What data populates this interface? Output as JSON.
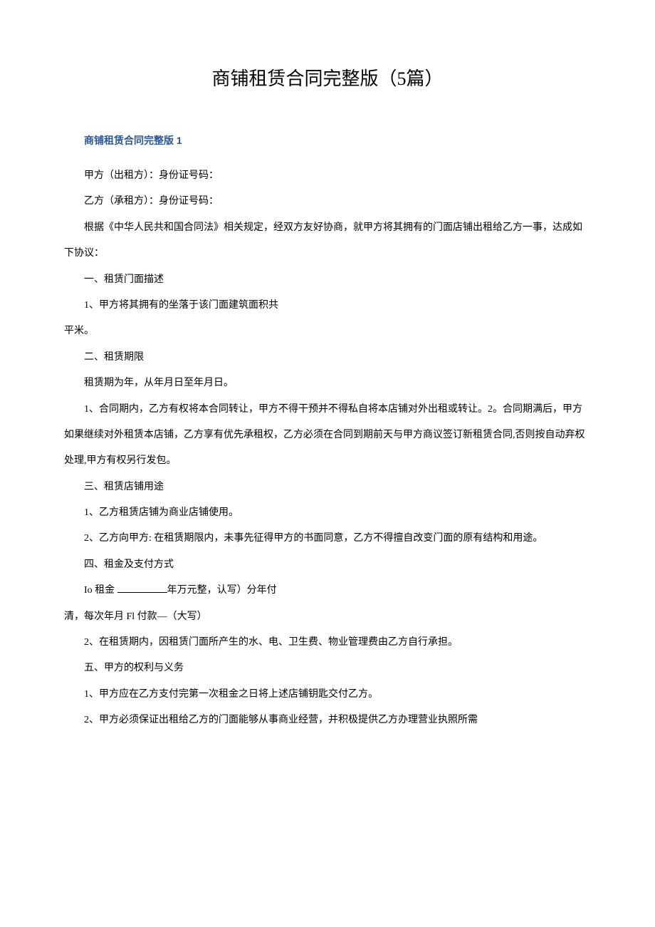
{
  "title": "商铺租赁合同完整版（5篇）",
  "subheading": "商铺租赁合同完整版 1",
  "paragraphs": {
    "p1": "甲方（出租方）：身份证号码：",
    "p2": "乙方（承租方）：身份证号码：",
    "p3": "根据《中华人民共和国合同法》相关规定，经双方友好协商，就甲方将其拥有的门面店铺出租给乙方一事，达成如下协议：",
    "p4": "一、租赁门面描述",
    "p5": "1、甲方将其拥有的坐落于该门面建筑面积共",
    "p6": "平米。",
    "p7": "二、租赁期限",
    "p8": "租赁期为年，从年月日至年月日。",
    "p9": "1、合同期内，乙方有权将本合同转让，甲方不得干预并不得私自将本店铺对外出租或转让。2。合同期满后，甲方如果继续对外租赁本店铺，乙方享有优先承租权，乙方必须在合同到期前天与甲方商议签订新租赁合同,否则按自动弃权处理,甲方有权另行发包。",
    "p10": "三、租赁店铺用途",
    "p11": "1、乙方租赁店铺为商业店铺使用。",
    "p12": "2、乙方向甲方: 在租赁期限内，未事先征得甲方的书面同意，乙方不得擅自改变门面的原有结构和用途。",
    "p13": "四、租金及支付方式",
    "p14a": "Io 租金 ",
    "p14b": "年万元整，认写）分年付",
    "p15": "清，每次年月 Fl 付款—（大写）",
    "p16": "2、在租赁期内，因租赁门面所产生的水、电、卫生费、物业管理费由乙方自行承担。",
    "p17": "五、甲方的权利与义务",
    "p18": "1、甲方应在乙方支付完第一次租金之日将上述店铺钥匙交付乙方。",
    "p19": "2、甲方必须保证出租给乙方的门面能够从事商业经营，并积极提供乙方办理营业执照所需"
  }
}
